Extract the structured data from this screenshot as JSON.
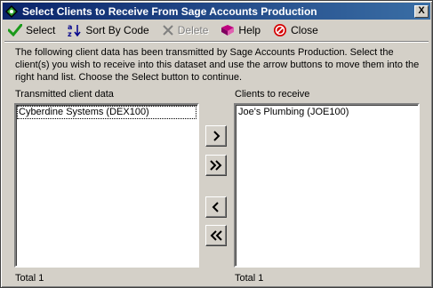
{
  "window": {
    "title": "Select Clients to Receive From Sage Accounts Production",
    "close_glyph": "X"
  },
  "toolbar": {
    "select": {
      "label": "Select",
      "icon": "checkmark-icon"
    },
    "sort": {
      "label": "Sort By Code",
      "icon": "sort-az-icon"
    },
    "delete": {
      "label": "Delete",
      "icon": "delete-x-icon",
      "disabled": true
    },
    "help": {
      "label": "Help",
      "icon": "help-book-icon"
    },
    "close": {
      "label": "Close",
      "icon": "close-stop-icon"
    }
  },
  "intro": "The following client data has been transmitted by Sage Accounts Production.  Select the client(s) you wish to receive into this dataset and use the arrow buttons to move them into the right hand list.  Choose the Select button to continue.",
  "left_list": {
    "label": "Transmitted client data",
    "items": [
      "Cyberdine Systems (DEX100)"
    ],
    "total": "Total 1"
  },
  "right_list": {
    "label": "Clients to receive",
    "items": [
      "Joe's Plumbing (JOE100)"
    ],
    "total": "Total 1"
  },
  "arrows": {
    "move_one": "right-arrow-icon",
    "move_all": "double-right-arrow-icon",
    "remove_one": "left-arrow-icon",
    "remove_all": "double-left-arrow-icon"
  },
  "colors": {
    "title_start": "#0a246a",
    "title_end": "#3a6ea5",
    "face": "#d4d0c8",
    "check_green": "#1a9a1a",
    "close_red": "#d40000"
  }
}
